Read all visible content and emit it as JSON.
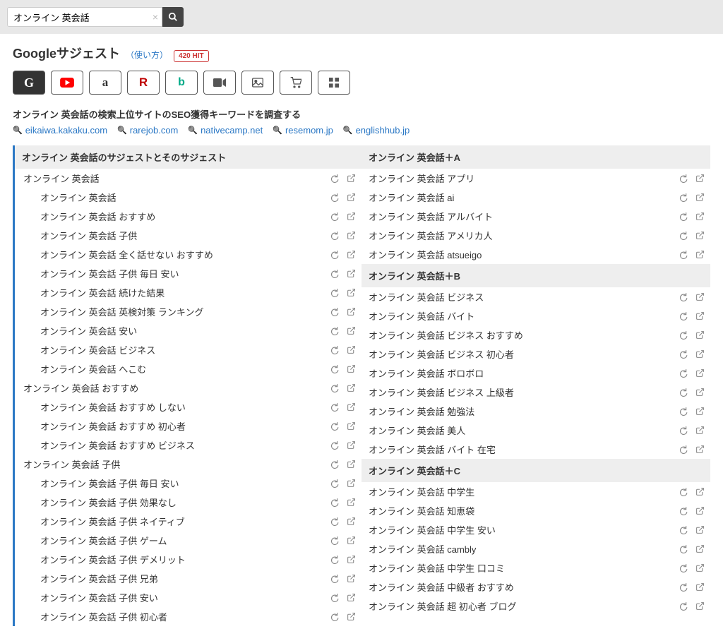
{
  "search": {
    "value": "オンライン 英会話"
  },
  "title": "Googleサジェスト",
  "title_sub": "（使い方）",
  "hit_badge": "420 HIT",
  "seo_title": "オンライン 英会話の検索上位サイトのSEO獲得キーワードを調査する",
  "seo_links": [
    "eikaiwa.kakaku.com",
    "rarejob.com",
    "nativecamp.net",
    "resemom.jp",
    "englishhub.jp"
  ],
  "left_header": "オンライン 英会話のサジェストとそのサジェスト",
  "left": [
    {
      "t": "オンライン 英会話",
      "l": 0
    },
    {
      "t": "オンライン 英会話",
      "l": 1
    },
    {
      "t": "オンライン 英会話 おすすめ",
      "l": 1
    },
    {
      "t": "オンライン 英会話 子供",
      "l": 1
    },
    {
      "t": "オンライン 英会話 全く話せない おすすめ",
      "l": 1
    },
    {
      "t": "オンライン 英会話 子供 毎日 安い",
      "l": 1
    },
    {
      "t": "オンライン 英会話 続けた結果",
      "l": 1
    },
    {
      "t": "オンライン 英会話 英検対策 ランキング",
      "l": 1
    },
    {
      "t": "オンライン 英会話 安い",
      "l": 1
    },
    {
      "t": "オンライン 英会話 ビジネス",
      "l": 1
    },
    {
      "t": "オンライン 英会話 へこむ",
      "l": 1
    },
    {
      "t": "オンライン 英会話 おすすめ",
      "l": 0
    },
    {
      "t": "オンライン 英会話 おすすめ しない",
      "l": 1
    },
    {
      "t": "オンライン 英会話 おすすめ 初心者",
      "l": 1
    },
    {
      "t": "オンライン 英会話 おすすめ ビジネス",
      "l": 1
    },
    {
      "t": "オンライン 英会話 子供",
      "l": 0
    },
    {
      "t": "オンライン 英会話 子供 毎日 安い",
      "l": 1
    },
    {
      "t": "オンライン 英会話 子供 効果なし",
      "l": 1
    },
    {
      "t": "オンライン 英会話 子供 ネイティブ",
      "l": 1
    },
    {
      "t": "オンライン 英会話 子供 ゲーム",
      "l": 1
    },
    {
      "t": "オンライン 英会話 子供 デメリット",
      "l": 1
    },
    {
      "t": "オンライン 英会話 子供 兄弟",
      "l": 1
    },
    {
      "t": "オンライン 英会話 子供 安い",
      "l": 1
    },
    {
      "t": "オンライン 英会話 子供 初心者",
      "l": 1
    }
  ],
  "right": [
    {
      "head": "オンライン 英会話＋A",
      "items": [
        "オンライン 英会話 アプリ",
        "オンライン 英会話 ai",
        "オンライン 英会話 アルバイト",
        "オンライン 英会話 アメリカ人",
        "オンライン 英会話 atsueigo"
      ]
    },
    {
      "head": "オンライン 英会話＋B",
      "items": [
        "オンライン 英会話 ビジネス",
        "オンライン 英会話 バイト",
        "オンライン 英会話 ビジネス おすすめ",
        "オンライン 英会話 ビジネス 初心者",
        "オンライン 英会話 ボロボロ",
        "オンライン 英会話 ビジネス 上級者",
        "オンライン 英会話 勉強法",
        "オンライン 英会話 美人",
        "オンライン 英会話 バイト 在宅"
      ]
    },
    {
      "head": "オンライン 英会話＋C",
      "items": [
        "オンライン 英会話 中学生",
        "オンライン 英会話 知恵袋",
        "オンライン 英会話 中学生 安い",
        "オンライン 英会話 cambly",
        "オンライン 英会話 中学生 口コミ",
        "オンライン 英会話 中級者 おすすめ",
        "オンライン 英会話 超 初心者 ブログ"
      ]
    }
  ]
}
